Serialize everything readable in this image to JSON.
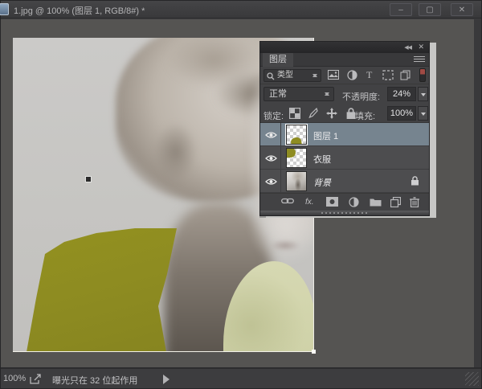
{
  "window": {
    "title": "1.jpg @ 100% (图层 1, RGB/8#) *",
    "buttons": {
      "minimize": "–",
      "maximize": "▢",
      "close": "✕"
    }
  },
  "panel": {
    "tab_label": "图层",
    "collapse_label": "◀◀",
    "close_label": "✕",
    "filter": {
      "type_label": "类型"
    },
    "blend": {
      "mode": "正常",
      "opacity_label": "不透明度:",
      "opacity_value": "24%"
    },
    "lock": {
      "label": "锁定:",
      "fill_label": "填充:",
      "fill_value": "100%"
    },
    "layers": [
      {
        "name": "图层 1",
        "selected": true
      },
      {
        "name": "衣服",
        "selected": false
      },
      {
        "name": "背景",
        "selected": false,
        "locked": true
      }
    ],
    "fx_label": "fx."
  },
  "statusbar": {
    "zoom_value": "100%",
    "message": "曝光只在 32 位起作用"
  },
  "colors": {
    "selected_row": "#76848f",
    "olive_paint": "#8e8c22",
    "pale_shirt": "#d3d5ac",
    "panel_bg": "#424244",
    "pasteboard": "#555452"
  }
}
